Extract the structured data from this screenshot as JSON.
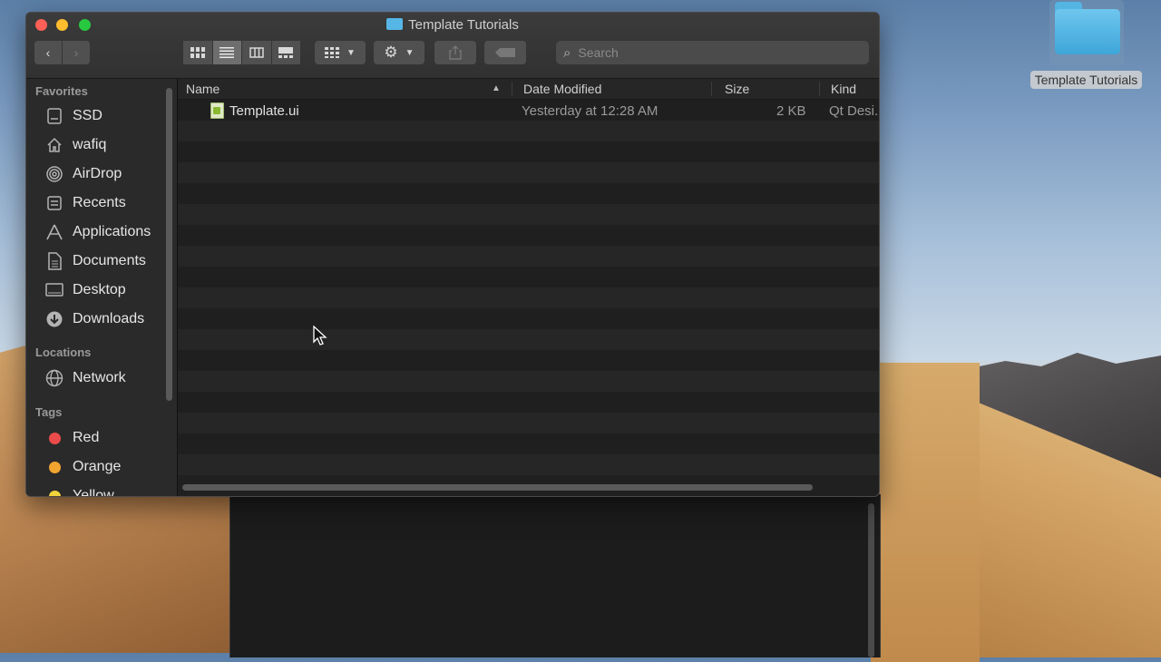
{
  "window": {
    "title": "Template Tutorials"
  },
  "toolbar": {
    "back_label": "‹",
    "forward_label": "›",
    "search_placeholder": "Search"
  },
  "sidebar": {
    "favorites_header": "Favorites",
    "favorites": [
      {
        "label": "SSD",
        "icon": "drive-icon"
      },
      {
        "label": "wafiq",
        "icon": "home-icon"
      },
      {
        "label": "AirDrop",
        "icon": "airdrop-icon"
      },
      {
        "label": "Recents",
        "icon": "recents-icon"
      },
      {
        "label": "Applications",
        "icon": "applications-icon"
      },
      {
        "label": "Documents",
        "icon": "documents-icon"
      },
      {
        "label": "Desktop",
        "icon": "desktop-icon"
      },
      {
        "label": "Downloads",
        "icon": "downloads-icon"
      }
    ],
    "locations_header": "Locations",
    "locations": [
      {
        "label": "Network",
        "icon": "network-icon"
      }
    ],
    "tags_header": "Tags",
    "tags": [
      {
        "label": "Red",
        "color": "#ec4b4b"
      },
      {
        "label": "Orange",
        "color": "#f0a530"
      },
      {
        "label": "Yellow",
        "color": "#f3d33b"
      }
    ]
  },
  "columns": {
    "name": "Name",
    "date_modified": "Date Modified",
    "size": "Size",
    "kind": "Kind"
  },
  "files": [
    {
      "name": "Template.ui",
      "date_modified": "Yesterday at 12:28 AM",
      "size": "2 KB",
      "kind": "Qt Desi..."
    }
  ],
  "desktop": {
    "folder_label": "Template Tutorials"
  }
}
